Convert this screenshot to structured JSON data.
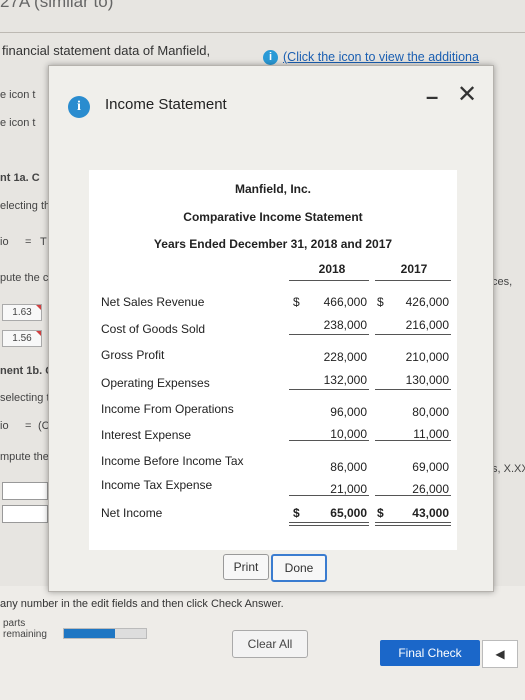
{
  "page": {
    "title": "27A (similar to)",
    "text_financial": "financial statement data of Manfield,",
    "link_text": "(Click the icon to view the additiona",
    "side_e1": "e icon t",
    "side_e2": "e icon t",
    "side_1a": "nt 1a. C",
    "side_selecting1": "electing th",
    "side_io1": "io",
    "side_eq1": "=",
    "side_T": "T",
    "side_pute1": "pute the c",
    "side_val1": "1.63",
    "side_val2": "1.56",
    "side_1b": "nent 1b. C",
    "side_selecting2": "selecting th",
    "side_io2": "io",
    "side_eq2": "=",
    "side_Ca": "(Ca",
    "side_pute2": "mpute the c",
    "right_ces": "ces,",
    "right_xxx": "s, X.XX",
    "hint": "any number in the edit fields and then click Check Answer.",
    "parts_label": "parts remaining",
    "progress": 0.62,
    "clear_all": "Clear All",
    "final_check": "Final Check",
    "arrow": "◀"
  },
  "dialog": {
    "title": "Income Statement",
    "minimize": "–",
    "close": "✕",
    "print": "Print",
    "done": "Done"
  },
  "statement": {
    "company": "Manfield, Inc.",
    "title": "Comparative Income Statement",
    "period": "Years Ended December 31, 2018 and 2017",
    "years": [
      "2018",
      "2017"
    ],
    "rows": [
      {
        "label": "Net Sales Revenue",
        "v2018": "466,000",
        "v2017": "426,000",
        "dollar": true
      },
      {
        "label": "Cost of Goods Sold",
        "v2018": "238,000",
        "v2017": "216,000"
      },
      {
        "label": "Gross Profit",
        "v2018": "228,000",
        "v2017": "210,000"
      },
      {
        "label": "Operating Expenses",
        "v2018": "132,000",
        "v2017": "130,000"
      },
      {
        "label": "Income From Operations",
        "v2018": "96,000",
        "v2017": "80,000"
      },
      {
        "label": "Interest Expense",
        "v2018": "10,000",
        "v2017": "11,000"
      },
      {
        "label": "Income Before Income Tax",
        "v2018": "86,000",
        "v2017": "69,000"
      },
      {
        "label": "Income Tax Expense",
        "v2018": "21,000",
        "v2017": "26,000"
      },
      {
        "label": "Net Income",
        "v2018": "65,000",
        "v2017": "43,000",
        "dollar": true
      }
    ],
    "dollar_sign": "$"
  }
}
